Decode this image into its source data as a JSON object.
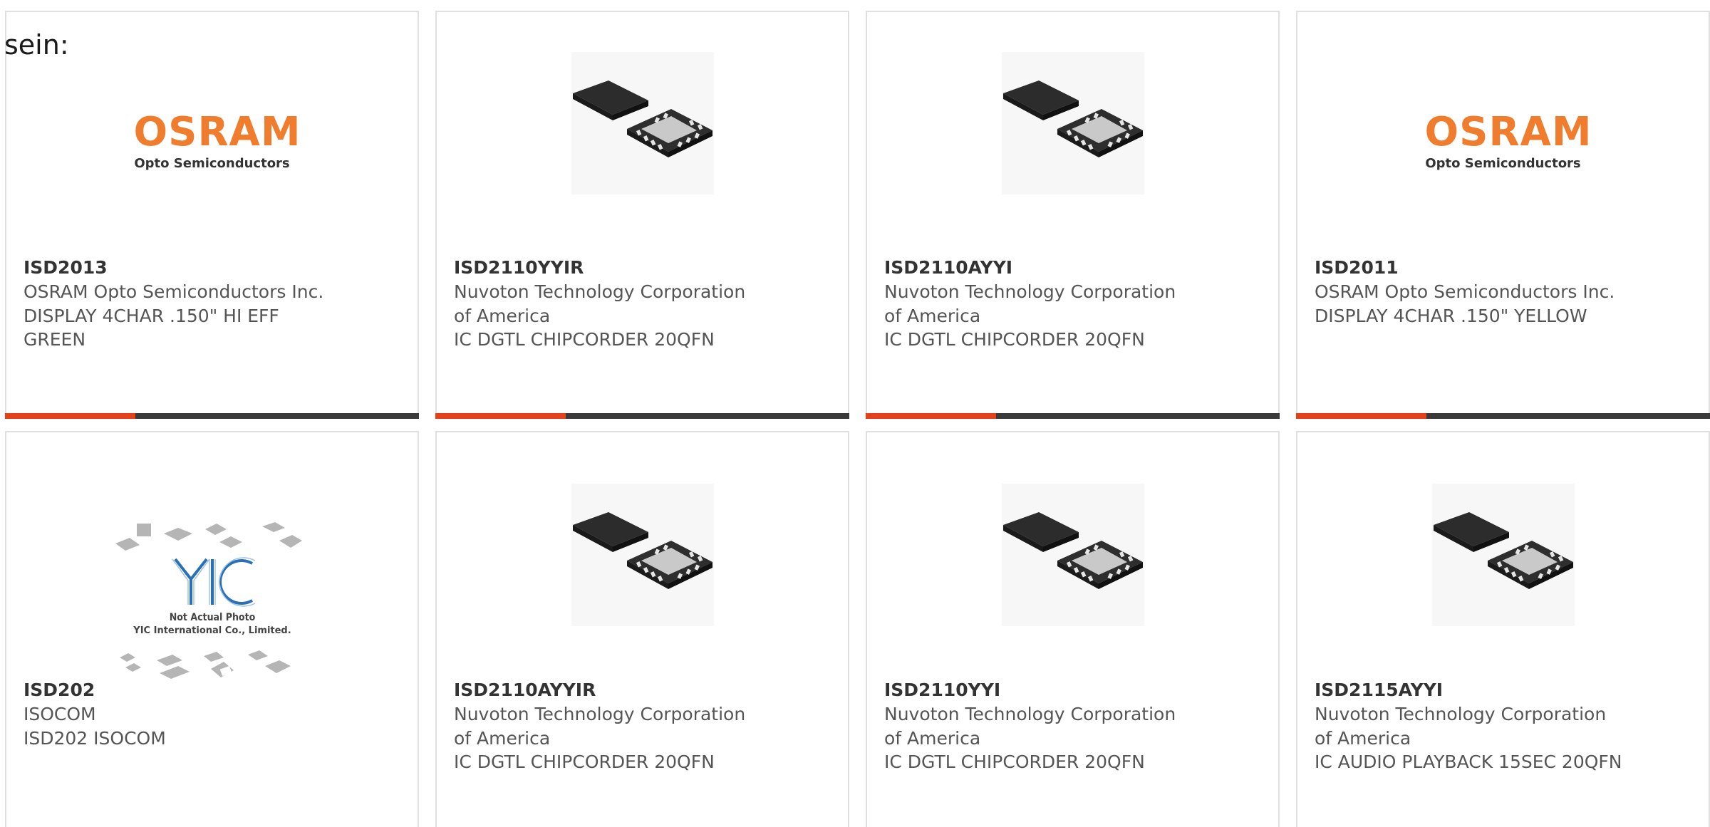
{
  "intro": "sein:",
  "colors": {
    "accent": "#e64018",
    "bar": "#3a3a3a",
    "osram_orange": "#ef7d2d"
  },
  "products": [
    {
      "part": "ISD2013",
      "maker": "OSRAM Opto Semiconductors Inc.",
      "desc": "DISPLAY 4CHAR .150\" HI EFF GREEN",
      "image": "osram-logo",
      "logo": {
        "word": "OSRAM",
        "sub": "Opto Semiconductors"
      }
    },
    {
      "part": "ISD2110YYIR",
      "maker": "Nuvoton Technology Corporation of America",
      "desc": "IC DGTL CHIPCORDER 20QFN",
      "image": "qfn-chip"
    },
    {
      "part": "ISD2110AYYI",
      "maker": "Nuvoton Technology Corporation of America",
      "desc": "IC DGTL CHIPCORDER 20QFN",
      "image": "qfn-chip"
    },
    {
      "part": "ISD2011",
      "maker": "OSRAM Opto Semiconductors Inc.",
      "desc": "DISPLAY 4CHAR .150\" YELLOW",
      "image": "osram-logo",
      "logo": {
        "word": "OSRAM",
        "sub": "Opto Semiconductors"
      }
    },
    {
      "part": "ISD202",
      "maker": "ISOCOM",
      "desc": "ISD202 ISOCOM",
      "image": "not-actual-photo",
      "placeholder": {
        "mark": "YIC",
        "line1": "Not Actual Photo",
        "line2": "YIC International Co., Limited."
      }
    },
    {
      "part": "ISD2110AYYIR",
      "maker": "Nuvoton Technology Corporation of America",
      "desc": "IC DGTL CHIPCORDER 20QFN",
      "image": "qfn-chip"
    },
    {
      "part": "ISD2110YYI",
      "maker": "Nuvoton Technology Corporation of America",
      "desc": "IC DGTL CHIPCORDER 20QFN",
      "image": "qfn-chip"
    },
    {
      "part": "ISD2115AYYI",
      "maker": "Nuvoton Technology Corporation of America",
      "desc": "IC AUDIO PLAYBACK 15SEC 20QFN",
      "image": "qfn-chip"
    }
  ]
}
